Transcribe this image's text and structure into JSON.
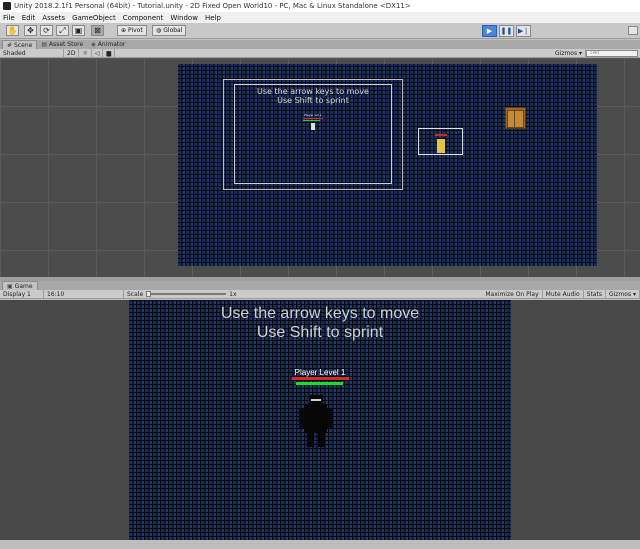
{
  "window": {
    "title": "Unity 2018.2.1f1 Personal (64bit) - Tutorial.unity - 2D Fixed Open World10 - PC, Mac & Linux Standalone <DX11>"
  },
  "menubar": {
    "items": [
      "File",
      "Edit",
      "Assets",
      "GameObject",
      "Component",
      "Window",
      "Help"
    ]
  },
  "toolbar": {
    "tools": [
      {
        "name": "hand-tool",
        "glyph": "✋"
      },
      {
        "name": "move-tool",
        "glyph": "✥"
      },
      {
        "name": "rotate-tool",
        "glyph": "⟳"
      },
      {
        "name": "scale-tool",
        "glyph": "⤢"
      },
      {
        "name": "rect-tool",
        "glyph": "▣"
      },
      {
        "name": "transform-tool",
        "glyph": "⊠"
      }
    ],
    "active_tool": "transform-tool",
    "pivot_label": "Pivot",
    "global_label": "Global",
    "play_state": "playing"
  },
  "scene_panel": {
    "tabs": [
      {
        "label": "Scene",
        "icon": "scene-icon",
        "selected": true
      },
      {
        "label": "Asset Store",
        "icon": "store-icon",
        "selected": false
      },
      {
        "label": "Animator",
        "icon": "animator-icon",
        "selected": false
      }
    ],
    "shading_mode": "Shaded",
    "mode_2d_label": "2D",
    "gizmos_label": "Gizmos ▾",
    "search_placeholder": "All",
    "hint_line1": "Use the arrow keys to move",
    "hint_line2": "Use Shift to sprint",
    "mini_player_label": "Player Lvl 1"
  },
  "game_panel": {
    "tab_label": "Game",
    "display_label": "Display 1",
    "aspect_label": "16:10",
    "scale_label": "Scale",
    "scale_value": "1x",
    "maximize_label": "Maximize On Play",
    "mute_label": "Mute Audio",
    "stats_label": "Stats",
    "gizmos_label": "Gizmos ▾",
    "hint_line1": "Use the arrow keys to move",
    "hint_line2": "Use Shift to sprint",
    "player_label": "Player Level 1",
    "player_health": 1.0,
    "player_stamina": 0.82
  },
  "colors": {
    "editor_bg": "#c2c2c2",
    "scene_bg": "#4c4c4c",
    "play_active": "#4a86d8",
    "health_bar": "#d42a2a",
    "stamina_bar": "#22dd22"
  }
}
